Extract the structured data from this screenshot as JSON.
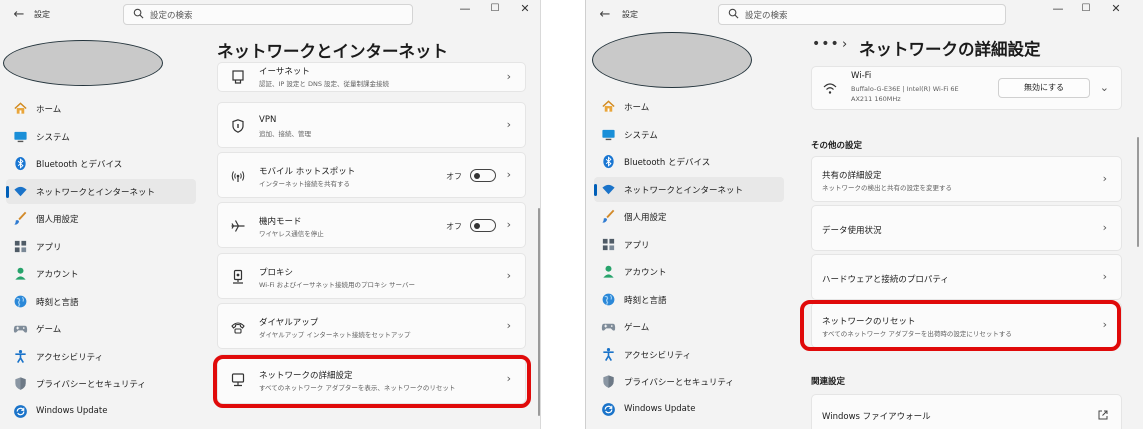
{
  "left": {
    "app_title": "設定",
    "search_placeholder": "設定の検索",
    "page_title": "ネットワークとインターネット",
    "nav": [
      {
        "label": "ホーム",
        "icon": "home-icon"
      },
      {
        "label": "システム",
        "icon": "monitor-icon"
      },
      {
        "label": "Bluetooth とデバイス",
        "icon": "bluetooth-icon"
      },
      {
        "label": "ネットワークとインターネット",
        "icon": "wifi-icon",
        "selected": true
      },
      {
        "label": "個人用設定",
        "icon": "brush-icon"
      },
      {
        "label": "アプリ",
        "icon": "apps-icon"
      },
      {
        "label": "アカウント",
        "icon": "person-icon"
      },
      {
        "label": "時刻と言語",
        "icon": "globe-icon"
      },
      {
        "label": "ゲーム",
        "icon": "gamepad-icon"
      },
      {
        "label": "アクセシビリティ",
        "icon": "accessibility-icon"
      },
      {
        "label": "プライバシーとセキュリティ",
        "icon": "shield-icon"
      },
      {
        "label": "Windows Update",
        "icon": "update-icon"
      }
    ],
    "cards": [
      {
        "title": "イーサネット",
        "subtitle": "認証、IP 設定と DNS 設定、従量制課金接続"
      },
      {
        "title": "VPN",
        "subtitle": "追加、接続、管理"
      },
      {
        "title": "モバイル ホットスポット",
        "subtitle": "インターネット接続を共有する",
        "toggle": "オフ"
      },
      {
        "title": "機内モード",
        "subtitle": "ワイヤレス通信を停止",
        "toggle": "オフ"
      },
      {
        "title": "プロキシ",
        "subtitle": "Wi-Fi およびイーサネット接続用のプロキシ サーバー"
      },
      {
        "title": "ダイヤルアップ",
        "subtitle": "ダイヤルアップ インターネット接続をセットアップ"
      },
      {
        "title": "ネットワークの詳細設定",
        "subtitle": "すべてのネットワーク アダプターを表示、ネットワークのリセット"
      }
    ]
  },
  "right": {
    "app_title": "設定",
    "search_placeholder": "設定の検索",
    "breadcrumb_dots": "•••",
    "page_title": "ネットワークの詳細設定",
    "nav": [
      {
        "label": "ホーム",
        "icon": "home-icon"
      },
      {
        "label": "システム",
        "icon": "monitor-icon"
      },
      {
        "label": "Bluetooth とデバイス",
        "icon": "bluetooth-icon"
      },
      {
        "label": "ネットワークとインターネット",
        "icon": "wifi-icon",
        "selected": true
      },
      {
        "label": "個人用設定",
        "icon": "brush-icon"
      },
      {
        "label": "アプリ",
        "icon": "apps-icon"
      },
      {
        "label": "アカウント",
        "icon": "person-icon"
      },
      {
        "label": "時刻と言語",
        "icon": "globe-icon"
      },
      {
        "label": "ゲーム",
        "icon": "gamepad-icon"
      },
      {
        "label": "アクセシビリティ",
        "icon": "accessibility-icon"
      },
      {
        "label": "プライバシーとセキュリティ",
        "icon": "shield-icon"
      },
      {
        "label": "Windows Update",
        "icon": "update-icon"
      }
    ],
    "wifi": {
      "name": "Wi-Fi",
      "desc_line1": "Buffalo-G-E36E | Intel(R) Wi-Fi 6E",
      "desc_line2": "AX211 160MHz",
      "disable_button": "無効にする"
    },
    "other_settings_header": "その他の設定",
    "other_cards": [
      {
        "title": "共有の詳細設定",
        "subtitle": "ネットワークの検出と共有の設定を変更する"
      },
      {
        "title": "データ使用状況",
        "subtitle": ""
      },
      {
        "title": "ハードウェアと接続のプロパティ",
        "subtitle": ""
      },
      {
        "title": "ネットワークのリセット",
        "subtitle": "すべてのネットワーク アダプターを出荷時の設定にリセットする"
      }
    ],
    "related_header": "関連設定",
    "related_cards": [
      {
        "title": "Windows ファイアウォール"
      }
    ]
  },
  "colors": {
    "accent": "#005fb8",
    "highlight": "#e00a0a",
    "window_bg": "#f3f3f3",
    "card_bg": "#fbfbfb"
  }
}
